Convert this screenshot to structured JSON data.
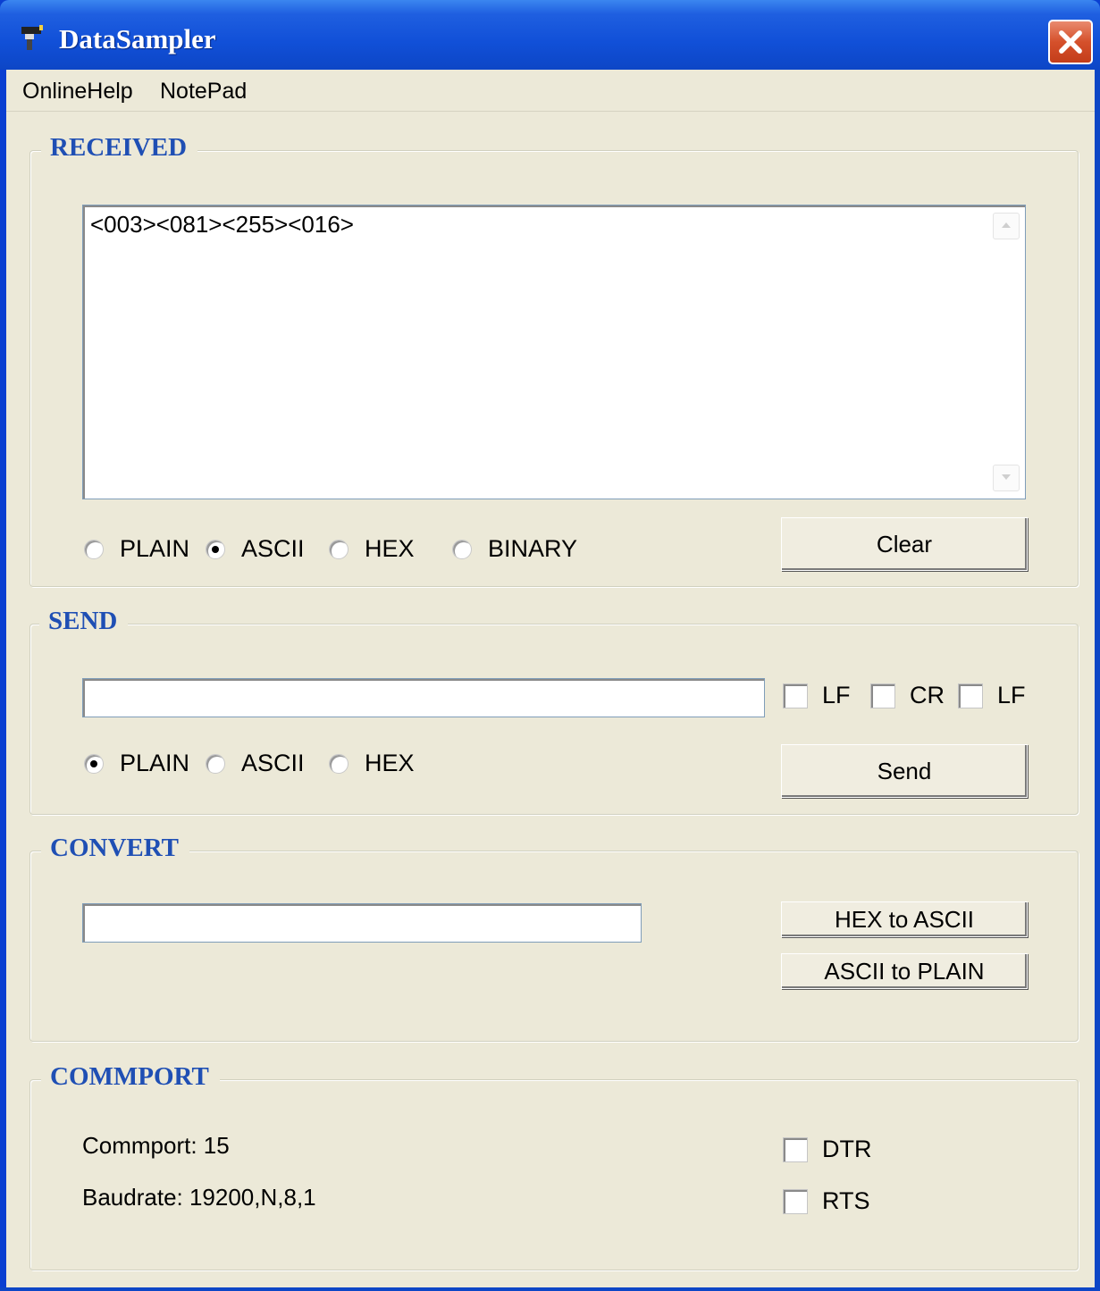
{
  "window": {
    "title": "DataSampler"
  },
  "menu": {
    "items": [
      "OnlineHelp",
      "NotePad"
    ]
  },
  "received": {
    "title": "RECEIVED",
    "text": "<003><081><255><016>",
    "radios": [
      {
        "label": "PLAIN",
        "checked": false
      },
      {
        "label": "ASCII",
        "checked": true
      },
      {
        "label": "HEX",
        "checked": false
      },
      {
        "label": "BINARY",
        "checked": false
      }
    ],
    "clear_label": "Clear"
  },
  "send": {
    "title": "SEND",
    "input_value": "",
    "checkboxes": [
      {
        "label": "LF",
        "checked": false
      },
      {
        "label": "CR",
        "checked": false
      },
      {
        "label": "LF",
        "checked": false
      }
    ],
    "radios": [
      {
        "label": "PLAIN",
        "checked": true
      },
      {
        "label": "ASCII",
        "checked": false
      },
      {
        "label": "HEX",
        "checked": false
      }
    ],
    "send_label": "Send"
  },
  "convert": {
    "title": "CONVERT",
    "input_value": "",
    "hex_to_ascii_label": "HEX to ASCII",
    "ascii_to_plain_label": "ASCII to PLAIN"
  },
  "commport": {
    "title": "COMMPORT",
    "commport_text": "Commport: 15",
    "baudrate_text": "Baudrate: 19200,N,8,1",
    "dtr_label": "DTR",
    "rts_label": "RTS",
    "dtr_checked": false,
    "rts_checked": false
  }
}
